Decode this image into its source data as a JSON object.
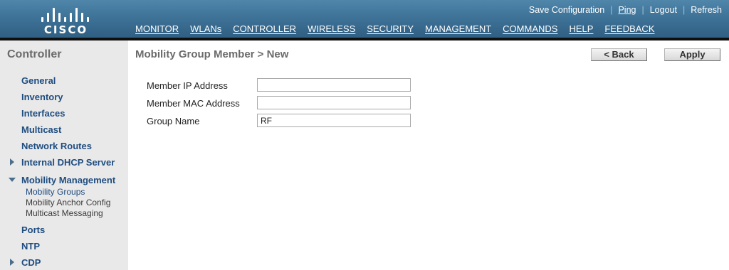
{
  "header": {
    "logo_text": "CISCO",
    "top_links": [
      "Save Configuration",
      "Ping",
      "Logout",
      "Refresh"
    ],
    "nav": [
      "MONITOR",
      "WLANs",
      "CONTROLLER",
      "WIRELESS",
      "SECURITY",
      "MANAGEMENT",
      "COMMANDS",
      "HELP",
      "FEEDBACK"
    ],
    "active_nav": "CONTROLLER",
    "active_accent_color": "#f39c12"
  },
  "sidebar": {
    "title": "Controller",
    "items": [
      {
        "label": "General"
      },
      {
        "label": "Inventory"
      },
      {
        "label": "Interfaces"
      },
      {
        "label": "Multicast"
      },
      {
        "label": "Network Routes"
      },
      {
        "label": "Internal DHCP Server",
        "expand_icon": "triangle-right"
      },
      {
        "label": "Mobility Management",
        "expand_icon": "triangle-down",
        "children": [
          "Mobility Groups",
          "Mobility Anchor Config",
          "Multicast Messaging"
        ]
      },
      {
        "label": "Ports"
      },
      {
        "label": "NTP"
      },
      {
        "label": "CDP",
        "expand_icon": "triangle-right"
      }
    ]
  },
  "main": {
    "title": "Mobility Group Member > New",
    "back_label": "< Back",
    "apply_label": "Apply",
    "fields": [
      {
        "label": "Member IP Address",
        "value": ""
      },
      {
        "label": "Member MAC Address",
        "value": ""
      },
      {
        "label": "Group Name",
        "value": "RF"
      }
    ]
  }
}
